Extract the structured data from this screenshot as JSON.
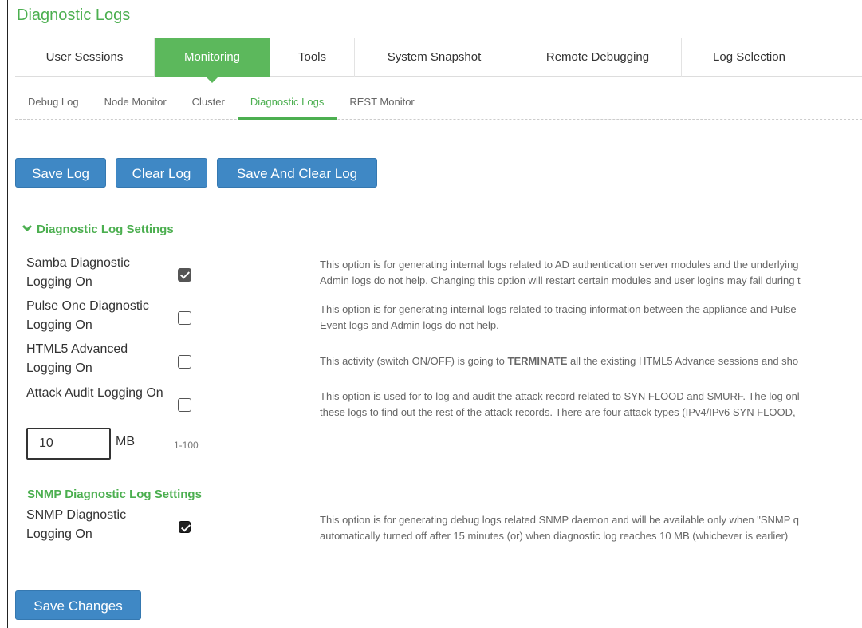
{
  "page_title": "Diagnostic Logs",
  "main_tabs": [
    {
      "label": "User Sessions",
      "active": false
    },
    {
      "label": "Monitoring",
      "active": true
    },
    {
      "label": "Tools",
      "active": false
    },
    {
      "label": "System Snapshot",
      "active": false
    },
    {
      "label": "Remote Debugging",
      "active": false
    },
    {
      "label": "Log Selection",
      "active": false
    }
  ],
  "sub_tabs": [
    {
      "label": "Debug Log",
      "active": false
    },
    {
      "label": "Node Monitor",
      "active": false
    },
    {
      "label": "Cluster",
      "active": false
    },
    {
      "label": "Diagnostic Logs",
      "active": true
    },
    {
      "label": "REST Monitor",
      "active": false
    }
  ],
  "actions": {
    "save_log": "Save Log",
    "clear_log": "Clear Log",
    "save_and_clear_log": "Save And Clear Log"
  },
  "diagnostic_settings": {
    "heading": "Diagnostic Log Settings",
    "options": [
      {
        "label": "Samba Diagnostic Logging On",
        "checked": true,
        "desc_line1": "This option is for generating internal logs related to AD authentication server modules and the underlying",
        "desc_line2": "Admin logs do not help. Changing this option will restart certain modules and user logins may fail during t"
      },
      {
        "label": "Pulse One Diagnostic Logging On",
        "checked": false,
        "desc_line1": "This option is for generating internal logs related to tracing information between the appliance and Pulse",
        "desc_line2": "Event logs and Admin logs do not help."
      },
      {
        "label": "HTML5 Advanced Logging On",
        "checked": false,
        "desc_pre": "This activity (switch ON/OFF) is going to ",
        "desc_strong": "TERMINATE",
        "desc_post": " all the existing HTML5 Advance sessions and sho"
      },
      {
        "label": "Attack Audit Logging On",
        "checked": false,
        "desc_line1": "This option is used for to log and audit the attack record related to SYN FLOOD and SMURF. The log onl",
        "desc_line2": "these logs to find out the rest of the attack records. There are four attack types (IPv4/IPv6 SYN FLOOD,"
      }
    ],
    "log_size": {
      "value": "10",
      "unit": "MB",
      "range": "1-100"
    }
  },
  "snmp_settings": {
    "heading": "SNMP Diagnostic Log Settings",
    "option": {
      "label": "SNMP Diagnostic Logging On",
      "checked": true,
      "desc_line1": "This option is for generating debug logs related SNMP daemon and will be available only when \"SNMP q",
      "desc_line2": "automatically turned off after 15 minutes (or) when diagnostic log reaches 10 MB (whichever is earlier)"
    }
  },
  "save_changes": "Save Changes",
  "colors": {
    "accent_green": "#5cb85c",
    "heading_green": "#4caf50",
    "button_blue": "#3f88c5"
  }
}
